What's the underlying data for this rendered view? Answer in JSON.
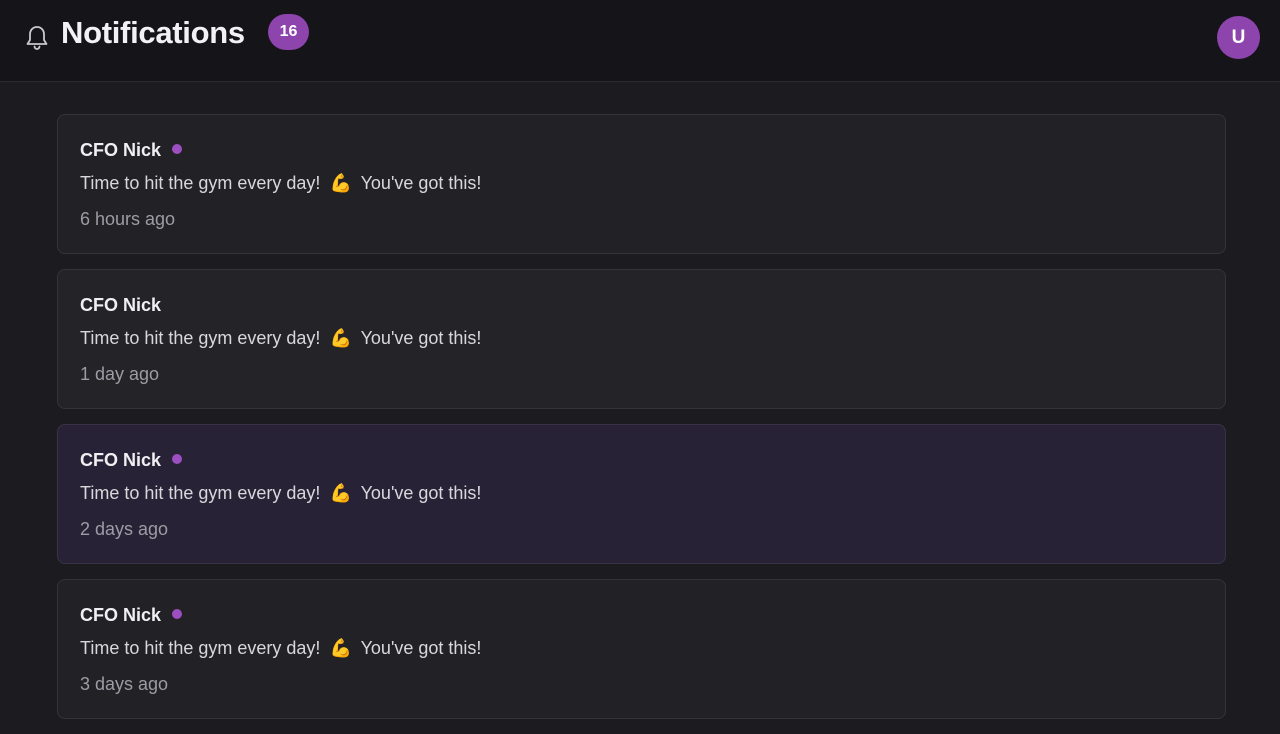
{
  "header": {
    "title": "Notifications",
    "badge_count": "16",
    "bell_icon": "bell-icon",
    "avatar_initial": "U"
  },
  "colors": {
    "accent": "#8e44ad",
    "background": "#1c1b20",
    "card": "#222126",
    "card_highlight": "#282236"
  },
  "notifications": [
    {
      "sender": "CFO Nick",
      "unread": true,
      "message_before": "Time to hit the gym every day!",
      "emoji": "💪",
      "message_after": "You've got this!",
      "time": "6 hours ago"
    },
    {
      "sender": "CFO Nick",
      "unread": false,
      "message_before": "Time to hit the gym every day!",
      "emoji": "💪",
      "message_after": "You've got this!",
      "time": "1 day ago"
    },
    {
      "sender": "CFO Nick",
      "unread": true,
      "message_before": "Time to hit the gym every day!",
      "emoji": "💪",
      "message_after": "You've got this!",
      "time": "2 days ago"
    },
    {
      "sender": "CFO Nick",
      "unread": true,
      "message_before": "Time to hit the gym every day!",
      "emoji": "💪",
      "message_after": "You've got this!",
      "time": "3 days ago"
    }
  ]
}
